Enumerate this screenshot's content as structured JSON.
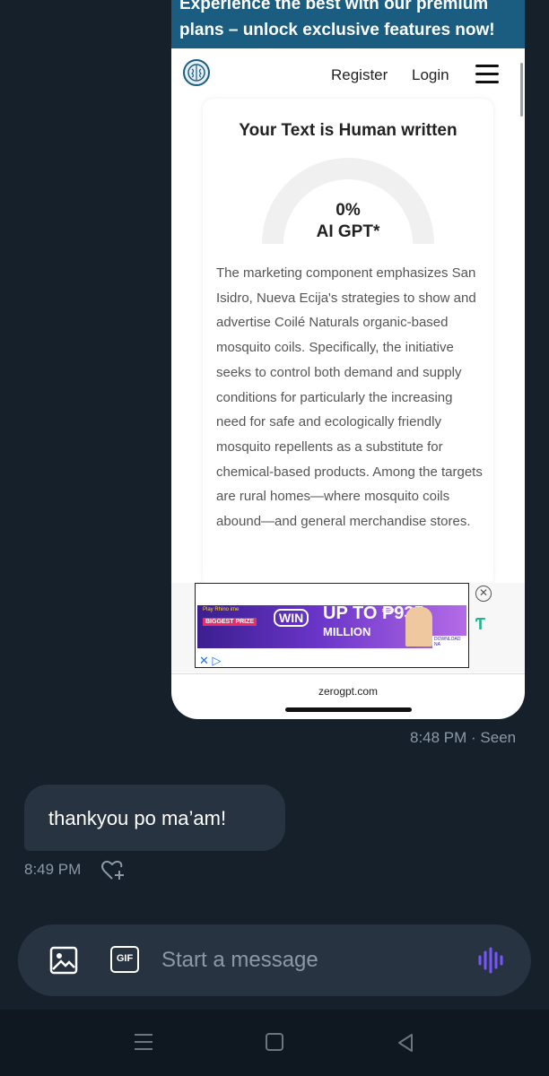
{
  "screenshot": {
    "banner": {
      "line1": "Experience the best with our premium",
      "line2": "plans – unlock exclusive features now!"
    },
    "nav": {
      "logo_icon": "brain-logo-icon",
      "register": "Register",
      "login": "Login",
      "menu_icon": "hamburger-menu-icon"
    },
    "card": {
      "title": "Your Text is Human written",
      "gauge_percent": 0,
      "gauge_value": "0%",
      "gauge_label": "AI GPT*",
      "body": "The marketing component emphasizes San Isidro, Nueva Ecija's strategies to show and advertise Coilé Naturals organic-based mosquito coils. Specifically, the initiative seeks to control both demand and supply conditions for particularly the increasing need for safe and ecologically friendly mosquito repellents as a substitute for chemical-based products. Among the targets are rural homes—where mosquito coils abound—and general merchandise stores."
    },
    "ad": {
      "tiny_text": "Play Rhino ime",
      "badge": "BIGGEST PRIZE",
      "headline": "WIN",
      "prize": "UP TO ₱935",
      "prize_unit": "MILLION",
      "cta": "DOWNLOAD NA",
      "choices": "✕ ▷",
      "close_icon": "close-circle-icon",
      "logo_icon": "ad-provider-icon"
    },
    "url": "zerogpt.com"
  },
  "sent_meta": "8:48 PM · Seen",
  "received": {
    "text": "thankyou po ma’am!",
    "time": "8:49 PM",
    "react_icon": "heart-plus-icon"
  },
  "composer": {
    "image_icon": "image-icon",
    "gif_label": "GIF",
    "placeholder": "Start a message",
    "voice_icon": "voice-waveform-icon"
  },
  "colors": {
    "background": "#15202b",
    "bubble": "#273340",
    "muted_text": "#8b98a5",
    "accent_purple": "#7856ff",
    "banner": "#1b5d80"
  }
}
